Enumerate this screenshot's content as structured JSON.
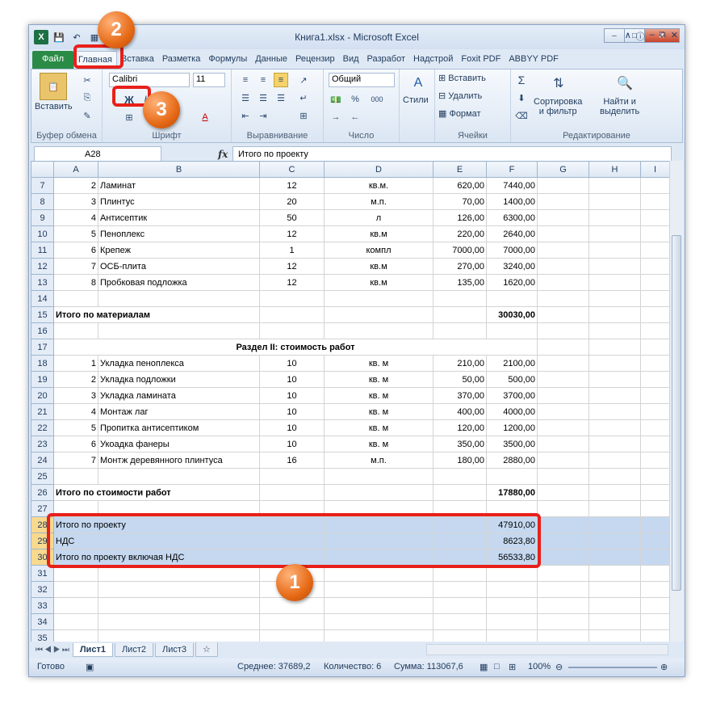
{
  "title": "Книга1.xlsx - Microsoft Excel",
  "qat": {
    "logo_icon": "X",
    "save_icon": "save-icon",
    "undo_icon": "undo-icon"
  },
  "tabs": [
    "Файл",
    "Главная",
    "Вставка",
    "Разметка",
    "Формулы",
    "Данные",
    "Рецензир",
    "Вид",
    "Разработ",
    "Надстрой",
    "Foxit PDF",
    "ABBYY PDF"
  ],
  "ribbon": {
    "paste_label": "Вставить",
    "font_name": "Calibri",
    "font_size": "11",
    "bold_label": "Ж",
    "number_format": "Общий",
    "percent": "%",
    "thousands": "000",
    "styles_label": "Стили",
    "insert_label": "Вставить",
    "delete_label": "Удалить",
    "format_label": "Формат",
    "sort_label": "Сортировка\nи фильтр",
    "sort_line1": "Сортировка",
    "sort_line2": "и фильтр",
    "find_line1": "Найти и",
    "find_line2": "выделить",
    "groups": [
      "Буфер обмена",
      "Шрифт",
      "Выравнивание",
      "Число",
      "Ячейки",
      "Редактирование"
    ]
  },
  "formula_bar": {
    "cell_ref": "A28",
    "fx": "fx",
    "content": "Итого по проекту"
  },
  "columns": [
    "A",
    "B",
    "C",
    "D",
    "E",
    "F",
    "G",
    "H",
    "I"
  ],
  "rows": [
    {
      "n": "7",
      "a": "2",
      "b": "Ламинат",
      "c": "12",
      "d": "кв.м.",
      "e": "620,00",
      "f": "7440,00"
    },
    {
      "n": "8",
      "a": "3",
      "b": "Плинтус",
      "c": "20",
      "d": "м.п.",
      "e": "70,00",
      "f": "1400,00"
    },
    {
      "n": "9",
      "a": "4",
      "b": "Антисептик",
      "c": "50",
      "d": "л",
      "e": "126,00",
      "f": "6300,00"
    },
    {
      "n": "10",
      "a": "5",
      "b": "Пеноплекс",
      "c": "12",
      "d": "кв.м",
      "e": "220,00",
      "f": "2640,00"
    },
    {
      "n": "11",
      "a": "6",
      "b": "Крепеж",
      "c": "1",
      "d": "компл",
      "e": "7000,00",
      "f": "7000,00"
    },
    {
      "n": "12",
      "a": "7",
      "b": "ОСБ-плита",
      "c": "12",
      "d": "кв.м",
      "e": "270,00",
      "f": "3240,00"
    },
    {
      "n": "13",
      "a": "8",
      "b": "Пробковая подложка",
      "c": "12",
      "d": "кв.м",
      "e": "135,00",
      "f": "1620,00"
    },
    {
      "n": "14",
      "a": "",
      "b": "",
      "c": "",
      "d": "",
      "e": "",
      "f": ""
    },
    {
      "n": "15",
      "span": "Итого по материалам",
      "f": "30030,00",
      "bold": true
    },
    {
      "n": "16",
      "a": "",
      "b": "",
      "c": "",
      "d": "",
      "e": "",
      "f": ""
    },
    {
      "n": "17",
      "section": "Раздел II: стоимость работ"
    },
    {
      "n": "18",
      "a": "1",
      "b": "Укладка пеноплекса",
      "c": "10",
      "d": "кв. м",
      "e": "210,00",
      "f": "2100,00"
    },
    {
      "n": "19",
      "a": "2",
      "b": "Укладка подложки",
      "c": "10",
      "d": "кв. м",
      "e": "50,00",
      "f": "500,00"
    },
    {
      "n": "20",
      "a": "3",
      "b": "Укладка  ламината",
      "c": "10",
      "d": "кв. м",
      "e": "370,00",
      "f": "3700,00"
    },
    {
      "n": "21",
      "a": "4",
      "b": "Монтаж лаг",
      "c": "10",
      "d": "кв. м",
      "e": "400,00",
      "f": "4000,00"
    },
    {
      "n": "22",
      "a": "5",
      "b": "Пропитка антисептиком",
      "c": "10",
      "d": "кв. м",
      "e": "120,00",
      "f": "1200,00"
    },
    {
      "n": "23",
      "a": "6",
      "b": "Укоадка фанеры",
      "c": "10",
      "d": "кв. м",
      "e": "350,00",
      "f": "3500,00"
    },
    {
      "n": "24",
      "a": "7",
      "b": "Монтж деревянного плинтуса",
      "c": "16",
      "d": "м.п.",
      "e": "180,00",
      "f": "2880,00"
    },
    {
      "n": "25",
      "a": "",
      "b": "",
      "c": "",
      "d": "",
      "e": "",
      "f": ""
    },
    {
      "n": "26",
      "span": "Итого по стоимости работ",
      "f": "17880,00",
      "bold": true
    },
    {
      "n": "27",
      "a": "",
      "b": "",
      "c": "",
      "d": "",
      "e": "",
      "f": ""
    },
    {
      "n": "28",
      "span": "Итого по проекту",
      "f": "47910,00",
      "sel": true
    },
    {
      "n": "29",
      "span": "НДС",
      "f": "8623,80",
      "sel": true
    },
    {
      "n": "30",
      "span": "Итого по проекту включая НДС",
      "f": "56533,80",
      "sel": true
    },
    {
      "n": "31",
      "a": "",
      "b": "",
      "c": "",
      "d": "",
      "e": "",
      "f": ""
    },
    {
      "n": "32",
      "a": "",
      "b": "",
      "c": "",
      "d": "",
      "e": "",
      "f": ""
    },
    {
      "n": "33",
      "a": "",
      "b": "",
      "c": "",
      "d": "",
      "e": "",
      "f": ""
    },
    {
      "n": "34",
      "a": "",
      "b": "",
      "c": "",
      "d": "",
      "e": "",
      "f": ""
    },
    {
      "n": "35",
      "a": "",
      "b": "",
      "c": "",
      "d": "",
      "e": "",
      "f": ""
    }
  ],
  "sheets": [
    "Лист1",
    "Лист2",
    "Лист3"
  ],
  "status": {
    "ready": "Готово",
    "average": "Среднее: 37689,2",
    "count": "Количество: 6",
    "sum": "Сумма: 113067,6",
    "zoom": "100%"
  },
  "callouts": [
    "1",
    "2",
    "3"
  ],
  "colors": {
    "highlight": "#e8201a",
    "badge": "#e66a16",
    "selection": "#c5d8f0"
  }
}
